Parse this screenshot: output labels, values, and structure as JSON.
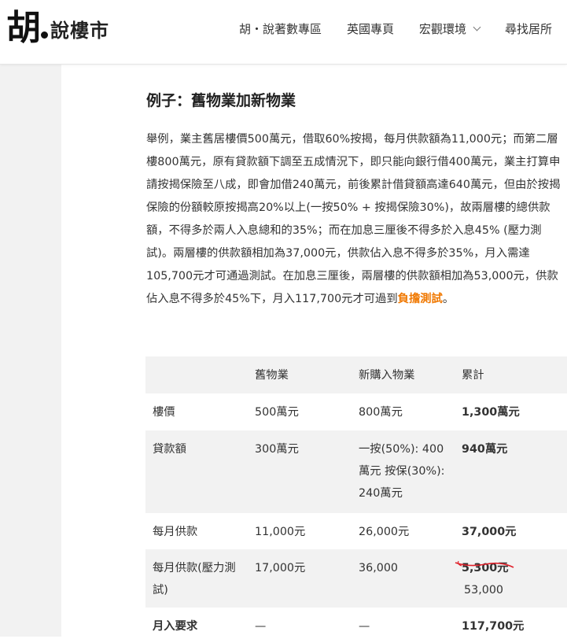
{
  "header": {
    "logo_mark": "胡",
    "logo_text": "說樓市",
    "nav": [
      {
        "label": "胡・說著數專區",
        "dropdown": false
      },
      {
        "label": "英國專頁",
        "dropdown": false
      },
      {
        "label": "宏觀環境",
        "dropdown": true
      },
      {
        "label": "尋找居所",
        "dropdown": false
      }
    ]
  },
  "article": {
    "section_title": "例子：舊物業加新物業",
    "paragraph_main": "舉例，業主舊居樓價500萬元，借取60%按揭，每月供款額為11,000元；而第二層樓800萬元，原有貸款額下調至五成情況下，即只能向銀行借400萬元，業主打算申請按揭保險至八成，即會加借240萬元，前後累計借貸額高達640萬元，但由於按揭保險的份額較原按揭高20%以上(一按50% + 按揭保險30%)，故兩層樓的總供款額，不得多於兩人入息總和的35%；而在加息三厘後不得多於入息45% (壓力測試)。兩層樓的供款額相加為37,000元，供款佔入息不得多於35%，月入需達105,700元才可通過測試。在加息三厘後，兩層樓的供款額相加為53,000元，供款佔入息不得多於45%下，月入117,700元才可過到",
    "paragraph_link": "負擔測試",
    "paragraph_end": "。",
    "link_color": "#f07800"
  },
  "table": {
    "headers": [
      "",
      "舊物業",
      "新購入物業",
      "累計"
    ],
    "rows": [
      {
        "label": "樓價",
        "old": "500萬元",
        "new": "800萬元",
        "total": "1,300萬元"
      },
      {
        "label": "貸款額",
        "old": "300萬元",
        "new": "一按(50%): 400萬元 按保(30%): 240萬元",
        "total": "940萬元"
      },
      {
        "label": "每月供款",
        "old": "11,000元",
        "new": "26,000元",
        "total": "37,000元"
      },
      {
        "label": "每月供款(壓力測試)",
        "old": "17,000元",
        "new": "36,000",
        "total_struck": "5,300元",
        "total": "53,000"
      },
      {
        "label": "月入要求",
        "old": "—",
        "new": "—",
        "total": "117,700元"
      }
    ],
    "strike_color": "#e0202a",
    "stripe_color": "#f2f2f2"
  }
}
